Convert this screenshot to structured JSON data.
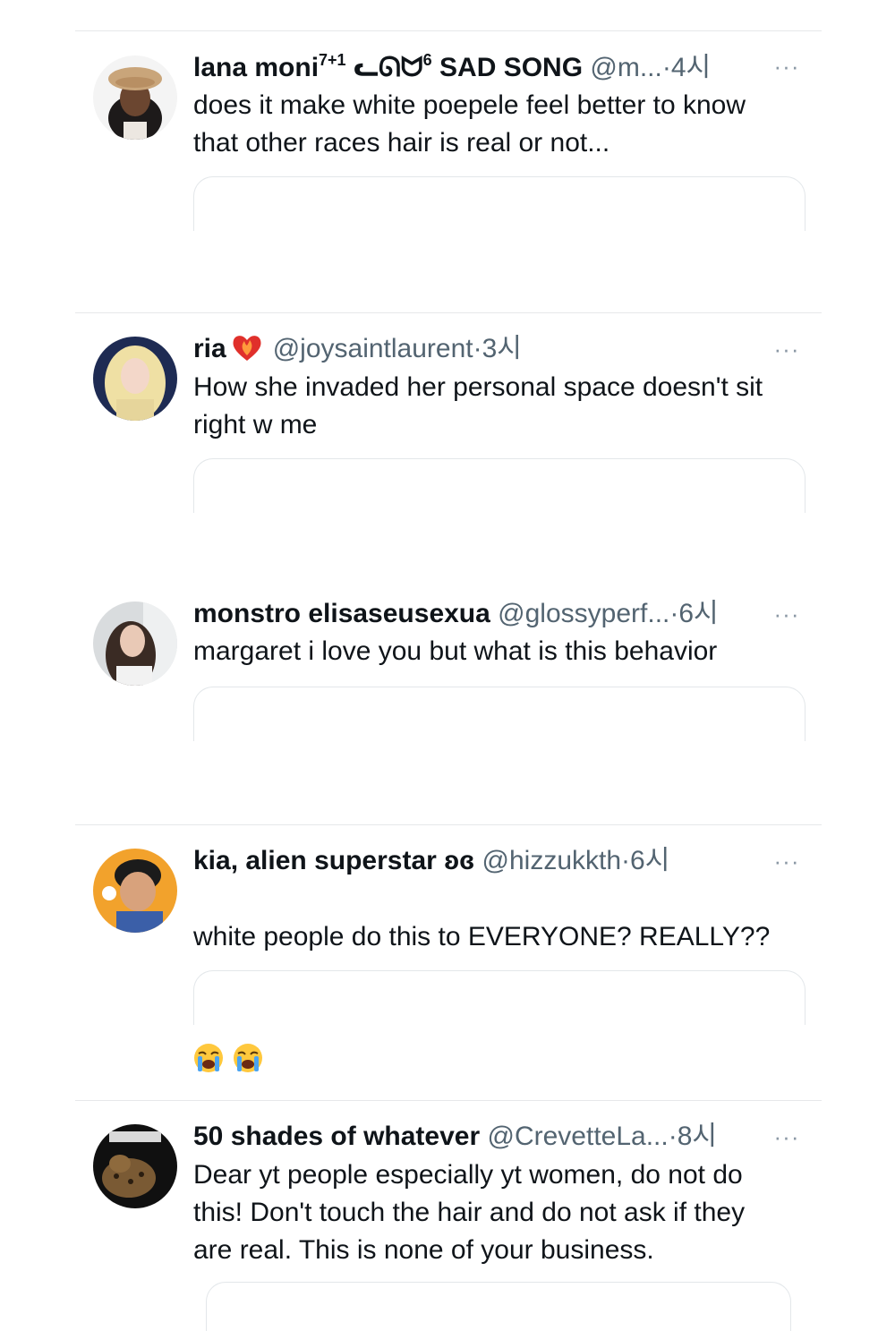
{
  "tweets": [
    {
      "name": "lana moni",
      "name_sup": "7+1",
      "name_glyphs": "ᓚᘏᗢ",
      "name_sup2": "6",
      "name_suffix": "SAD SONG",
      "handle": "@m...",
      "dot": "·",
      "time": "4시",
      "more": "···",
      "text": "does it make white poepele feel better to know\nthat other races hair is real or not..."
    },
    {
      "name": "ria",
      "handle": "@joysaintlaurent",
      "dot": "·",
      "time": "3시",
      "more": "···",
      "text": "How she invaded her personal space doesn't sit\nright w me"
    },
    {
      "name": "monstro elisaseusexua",
      "handle": "@glossyperf...",
      "dot": "·",
      "time": "6시",
      "more": "···",
      "text": "margaret i love you but what is this behavior"
    },
    {
      "name": "kia, alien superstar ʚɞ",
      "handle": "@hizzukkth",
      "dot": "·",
      "time": "6시",
      "more": "···",
      "text": "white people do this to EVERYONE? REALLY??"
    },
    {
      "name": "50 shades of whatever",
      "handle": "@CrevetteLa...",
      "dot": "·",
      "time": "8시",
      "more": "···",
      "text": "Dear yt people especially yt women, do not do\nthis! Don't touch the hair and do not ask if they\nare real.  This is none of your business."
    }
  ],
  "icons": {
    "more": "more-options-icon",
    "heart": "heart-on-fire-icon",
    "emoji": "loudly-crying-face-icon"
  },
  "colors": {
    "text": "#0f1419",
    "secondary": "#536471",
    "divider": "#e6e8ea"
  }
}
